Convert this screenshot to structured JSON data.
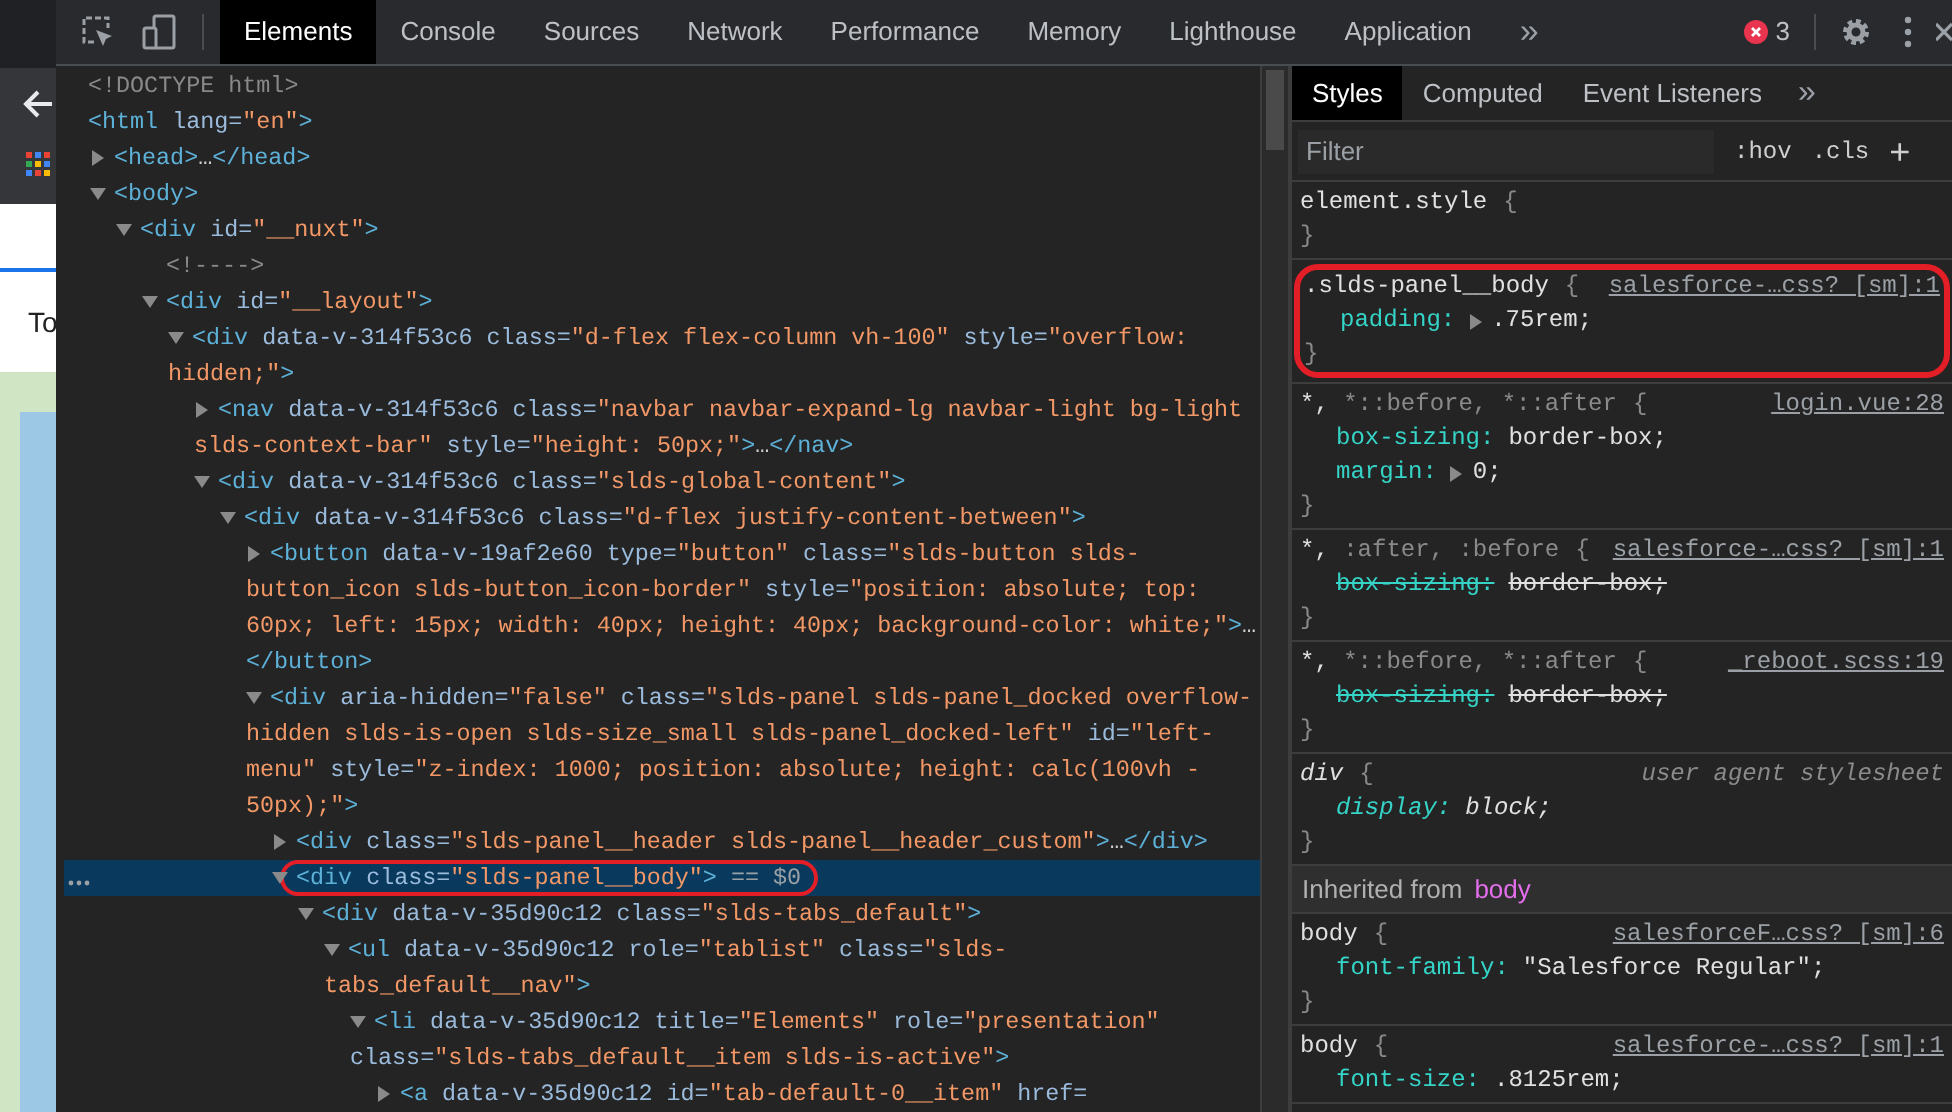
{
  "page_behind": {
    "text": "To"
  },
  "toolbar": {
    "tabs": [
      {
        "label": "Elements",
        "selected": true
      },
      {
        "label": "Console",
        "selected": false
      },
      {
        "label": "Sources",
        "selected": false
      },
      {
        "label": "Network",
        "selected": false
      },
      {
        "label": "Performance",
        "selected": false
      },
      {
        "label": "Memory",
        "selected": false
      },
      {
        "label": "Lighthouse",
        "selected": false
      },
      {
        "label": "Application",
        "selected": false
      }
    ],
    "more": "»",
    "error_count": "3"
  },
  "elements": {
    "tree": [
      {
        "parts": [
          {
            "kind": "comment",
            "text": "<!DOCTYPE html>"
          }
        ],
        "selected": false,
        "circled": false
      },
      {
        "parts": [
          {
            "kind": "tag",
            "text": "<html"
          },
          {
            "kind": "attr",
            "text": " lang="
          },
          {
            "kind": "value",
            "text": "\"en\""
          },
          {
            "kind": "tag",
            "text": ">"
          }
        ],
        "selected": false,
        "circled": false,
        "children": [
          {
            "parts": [
              {
                "kind": "tag",
                "text": "<head>"
              },
              {
                "kind": "plain",
                "text": "…"
              },
              {
                "kind": "tag",
                "text": "</head>"
              }
            ],
            "expanded": false,
            "selected": false,
            "circled": false
          },
          {
            "parts": [
              {
                "kind": "tag",
                "text": "<body>"
              }
            ],
            "expanded": true,
            "selected": false,
            "circled": false,
            "children": [
              {
                "parts": [
                  {
                    "kind": "tag",
                    "text": "<div"
                  },
                  {
                    "kind": "attr",
                    "text": " id="
                  },
                  {
                    "kind": "value",
                    "text": "\"__nuxt\""
                  },
                  {
                    "kind": "tag",
                    "text": ">"
                  }
                ],
                "expanded": true,
                "selected": false,
                "circled": false,
                "children": [
                  {
                    "parts": [
                      {
                        "kind": "comment",
                        "text": "<!---->"
                      }
                    ],
                    "selected": false,
                    "circled": false
                  },
                  {
                    "parts": [
                      {
                        "kind": "tag",
                        "text": "<div"
                      },
                      {
                        "kind": "attr",
                        "text": " id="
                      },
                      {
                        "kind": "value",
                        "text": "\"__layout\""
                      },
                      {
                        "kind": "tag",
                        "text": ">"
                      }
                    ],
                    "expanded": true,
                    "selected": false,
                    "circled": false,
                    "children": [
                      {
                        "parts": [
                          {
                            "kind": "tag",
                            "text": "<div"
                          },
                          {
                            "kind": "attr",
                            "text": " data-v-314f53c6 class="
                          },
                          {
                            "kind": "value",
                            "text": "\"d-flex flex-column vh-100\""
                          },
                          {
                            "kind": "attr",
                            "text": " style="
                          },
                          {
                            "kind": "value",
                            "text": "\"overflow: hidden;\""
                          },
                          {
                            "kind": "tag",
                            "text": ">"
                          }
                        ],
                        "expanded": true,
                        "selected": false,
                        "circled": false,
                        "children": [
                          {
                            "parts": [
                              {
                                "kind": "tag",
                                "text": "<nav"
                              },
                              {
                                "kind": "attr",
                                "text": " data-v-314f53c6 class="
                              },
                              {
                                "kind": "value",
                                "text": "\"navbar navbar-expand-lg navbar-light bg-light slds-context-bar\""
                              },
                              {
                                "kind": "attr",
                                "text": " style="
                              },
                              {
                                "kind": "value",
                                "text": "\"height: 50px;\""
                              },
                              {
                                "kind": "tag",
                                "text": ">"
                              },
                              {
                                "kind": "plain",
                                "text": "…"
                              },
                              {
                                "kind": "tag",
                                "text": "</nav>"
                              }
                            ],
                            "expanded": false,
                            "selected": false,
                            "circled": false
                          },
                          {
                            "parts": [
                              {
                                "kind": "tag",
                                "text": "<div"
                              },
                              {
                                "kind": "attr",
                                "text": " data-v-314f53c6 class="
                              },
                              {
                                "kind": "value",
                                "text": "\"slds-global-content\""
                              },
                              {
                                "kind": "tag",
                                "text": ">"
                              }
                            ],
                            "expanded": true,
                            "selected": false,
                            "circled": false,
                            "children": [
                              {
                                "parts": [
                                  {
                                    "kind": "tag",
                                    "text": "<div"
                                  },
                                  {
                                    "kind": "attr",
                                    "text": " data-v-314f53c6 class="
                                  },
                                  {
                                    "kind": "value",
                                    "text": "\"d-flex justify-content-between\""
                                  },
                                  {
                                    "kind": "tag",
                                    "text": ">"
                                  }
                                ],
                                "expanded": true,
                                "selected": false,
                                "circled": false,
                                "children": [
                                  {
                                    "parts": [
                                      {
                                        "kind": "tag",
                                        "text": "<button"
                                      },
                                      {
                                        "kind": "attr",
                                        "text": " data-v-19af2e60 type="
                                      },
                                      {
                                        "kind": "value",
                                        "text": "\"button\""
                                      },
                                      {
                                        "kind": "attr",
                                        "text": " class="
                                      },
                                      {
                                        "kind": "value",
                                        "text": "\"slds-button slds-button_icon slds-button_icon-border\""
                                      },
                                      {
                                        "kind": "attr",
                                        "text": " style="
                                      },
                                      {
                                        "kind": "value",
                                        "text": "\"position: absolute; top: 60px; left: 15px; width: 40px; height: 40px; background-color: white;\""
                                      },
                                      {
                                        "kind": "tag",
                                        "text": ">"
                                      },
                                      {
                                        "kind": "plain",
                                        "text": "…"
                                      },
                                      {
                                        "kind": "tag",
                                        "text": "</button>"
                                      }
                                    ],
                                    "expanded": false,
                                    "selected": false,
                                    "circled": false
                                  },
                                  {
                                    "parts": [
                                      {
                                        "kind": "tag",
                                        "text": "<div"
                                      },
                                      {
                                        "kind": "attr",
                                        "text": " aria-hidden="
                                      },
                                      {
                                        "kind": "value",
                                        "text": "\"false\""
                                      },
                                      {
                                        "kind": "attr",
                                        "text": " class="
                                      },
                                      {
                                        "kind": "value",
                                        "text": "\"slds-panel slds-panel_docked overflow-hidden slds-is-open slds-size_small slds-panel_docked-left\""
                                      },
                                      {
                                        "kind": "attr",
                                        "text": " id="
                                      },
                                      {
                                        "kind": "value",
                                        "text": "\"left-menu\""
                                      },
                                      {
                                        "kind": "attr",
                                        "text": " style="
                                      },
                                      {
                                        "kind": "value",
                                        "text": "\"z-index: 1000; position: absolute; height: calc(100vh - 50px);\""
                                      },
                                      {
                                        "kind": "tag",
                                        "text": ">"
                                      }
                                    ],
                                    "expanded": true,
                                    "selected": false,
                                    "circled": false,
                                    "children": [
                                      {
                                        "parts": [
                                          {
                                            "kind": "tag",
                                            "text": "<div"
                                          },
                                          {
                                            "kind": "attr",
                                            "text": " class="
                                          },
                                          {
                                            "kind": "value",
                                            "text": "\"slds-panel__header slds-panel__header_custom\""
                                          },
                                          {
                                            "kind": "tag",
                                            "text": ">"
                                          },
                                          {
                                            "kind": "plain",
                                            "text": "…"
                                          },
                                          {
                                            "kind": "tag",
                                            "text": "</div>"
                                          }
                                        ],
                                        "expanded": false,
                                        "selected": false,
                                        "circled": false
                                      },
                                      {
                                        "parts": [
                                          {
                                            "kind": "tag",
                                            "text": "<div"
                                          },
                                          {
                                            "kind": "attr",
                                            "text": " class="
                                          },
                                          {
                                            "kind": "value",
                                            "text": "\"slds-panel__body\""
                                          },
                                          {
                                            "kind": "tag",
                                            "text": ">"
                                          }
                                        ],
                                        "console_ref": "== $0",
                                        "expanded": true,
                                        "selected": true,
                                        "circled": true,
                                        "children": [
                                          {
                                            "parts": [
                                              {
                                                "kind": "tag",
                                                "text": "<div"
                                              },
                                              {
                                                "kind": "attr",
                                                "text": " data-v-35d90c12 class="
                                              },
                                              {
                                                "kind": "value",
                                                "text": "\"slds-tabs_default\""
                                              },
                                              {
                                                "kind": "tag",
                                                "text": ">"
                                              }
                                            ],
                                            "expanded": true,
                                            "selected": false,
                                            "circled": false,
                                            "children": [
                                              {
                                                "parts": [
                                                  {
                                                    "kind": "tag",
                                                    "text": "<ul"
                                                  },
                                                  {
                                                    "kind": "attr",
                                                    "text": " data-v-35d90c12 role="
                                                  },
                                                  {
                                                    "kind": "value",
                                                    "text": "\"tablist\""
                                                  },
                                                  {
                                                    "kind": "attr",
                                                    "text": " class="
                                                  },
                                                  {
                                                    "kind": "value",
                                                    "text": "\"slds-tabs_default__nav\""
                                                  },
                                                  {
                                                    "kind": "tag",
                                                    "text": ">"
                                                  }
                                                ],
                                                "expanded": true,
                                                "selected": false,
                                                "circled": false,
                                                "children": [
                                                  {
                                                    "parts": [
                                                      {
                                                        "kind": "tag",
                                                        "text": "<li"
                                                      },
                                                      {
                                                        "kind": "attr",
                                                        "text": " data-v-35d90c12 title="
                                                      },
                                                      {
                                                        "kind": "value",
                                                        "text": "\"Elements\""
                                                      },
                                                      {
                                                        "kind": "attr",
                                                        "text": " role="
                                                      },
                                                      {
                                                        "kind": "value",
                                                        "text": "\"presentation\""
                                                      },
                                                      {
                                                        "kind": "attr",
                                                        "text": " class="
                                                      },
                                                      {
                                                        "kind": "value",
                                                        "text": "\"slds-tabs_default__item slds-is-active\""
                                                      },
                                                      {
                                                        "kind": "tag",
                                                        "text": ">"
                                                      }
                                                    ],
                                                    "expanded": true,
                                                    "selected": false,
                                                    "circled": false,
                                                    "children": [
                                                      {
                                                        "parts": [
                                                          {
                                                            "kind": "tag",
                                                            "text": "<a"
                                                          },
                                                          {
                                                            "kind": "attr",
                                                            "text": " data-v-35d90c12 id="
                                                          },
                                                          {
                                                            "kind": "value",
                                                            "text": "\"tab-default-0__item\""
                                                          },
                                                          {
                                                            "kind": "attr",
                                                            "text": " href="
                                                          }
                                                        ],
                                                        "expanded": false,
                                                        "selected": false,
                                                        "circled": false
                                                      }
                                                    ]
                                                  }
                                                ]
                                              }
                                            ]
                                          }
                                        ]
                                      }
                                    ]
                                  }
                                ]
                              }
                            ]
                          }
                        ]
                      }
                    ]
                  }
                ]
              }
            ]
          }
        ]
      }
    ]
  },
  "styles": {
    "tabs": [
      {
        "label": "Styles",
        "selected": true
      },
      {
        "label": "Computed",
        "selected": false
      },
      {
        "label": "Event Listeners",
        "selected": false
      }
    ],
    "more": "»",
    "filter": {
      "placeholder": "Filter"
    },
    "hov": ":hov",
    "cls": ".cls",
    "add": "+",
    "rules": [
      {
        "selector": [
          {
            "text": "element.style",
            "matched": true
          }
        ],
        "open": "{",
        "close": "}",
        "kind": "rule",
        "circled": false
      },
      {
        "selector": [
          {
            "text": ".slds-panel__body",
            "matched": true
          }
        ],
        "open": "{",
        "close": "}",
        "source": "salesforce-…css? [sm]:1",
        "kind": "rule",
        "circled": true,
        "props": [
          {
            "name": "padding:",
            "value": ".75rem;",
            "expandable": true,
            "overridden": false
          }
        ]
      },
      {
        "selector": [
          {
            "text": "*,",
            "matched": true
          },
          {
            "text": " *::before, *::after",
            "matched": false
          }
        ],
        "open": "{",
        "close": "}",
        "source": "login.vue:28",
        "kind": "rule",
        "circled": false,
        "props": [
          {
            "name": "box-sizing:",
            "value": "border-box;",
            "expandable": false,
            "overridden": false
          },
          {
            "name": "margin:",
            "value": "0;",
            "expandable": true,
            "overridden": false
          }
        ]
      },
      {
        "selector": [
          {
            "text": "*,",
            "matched": true
          },
          {
            "text": " :after, :before",
            "matched": false
          }
        ],
        "open": "{",
        "close": "}",
        "source": "salesforce-…css? [sm]:1",
        "kind": "rule",
        "circled": false,
        "props": [
          {
            "name": "box-sizing:",
            "value": "border-box;",
            "expandable": false,
            "overridden": true
          }
        ]
      },
      {
        "selector": [
          {
            "text": "*,",
            "matched": true
          },
          {
            "text": " *::before, *::after",
            "matched": false
          }
        ],
        "open": "{",
        "close": "}",
        "source": "_reboot.scss:19",
        "kind": "rule",
        "circled": false,
        "props": [
          {
            "name": "box-sizing:",
            "value": "border-box;",
            "expandable": false,
            "overridden": true
          }
        ]
      },
      {
        "selector": [
          {
            "text": "div",
            "matched": true
          }
        ],
        "open": "{",
        "close": "}",
        "source": "user agent stylesheet",
        "kind": "user-agent-rule",
        "circled": false,
        "props": [
          {
            "name": "display:",
            "value": "block;",
            "expandable": false,
            "overridden": false
          }
        ]
      },
      {
        "kind": "inherited",
        "label": "Inherited from",
        "element": "body"
      },
      {
        "selector": [
          {
            "text": "body",
            "matched": true
          }
        ],
        "open": "{",
        "close": "}",
        "source": "salesforceF…css? [sm]:6",
        "kind": "rule",
        "circled": false,
        "props": [
          {
            "name": "font-family:",
            "value": "\"Salesforce Regular\";",
            "expandable": false,
            "overridden": false
          }
        ]
      },
      {
        "selector": [
          {
            "text": "body",
            "matched": true
          }
        ],
        "open": "{",
        "source": "salesforce-…css? [sm]:1",
        "kind": "rule",
        "circled": false,
        "props": [
          {
            "name": "font-size:",
            "value": ".8125rem;",
            "expandable": false,
            "overridden": false
          }
        ]
      }
    ]
  }
}
